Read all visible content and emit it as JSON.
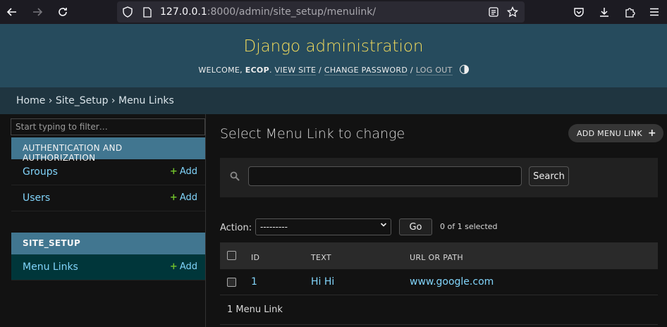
{
  "browser": {
    "url_host": "127.0.0.1",
    "url_path": ":8000/admin/site_setup/menulink/"
  },
  "header": {
    "brand": "Django administration",
    "welcome": "WELCOME, ",
    "username": "ECOP",
    "view_site": "VIEW SITE",
    "change_password": "CHANGE PASSWORD",
    "log_out": "LOG OUT",
    "sep": " / "
  },
  "breadcrumbs": {
    "home": "Home",
    "app": "Site_Setup",
    "current": "Menu Links",
    "sep": " › "
  },
  "sidebar": {
    "filter_placeholder": "Start typing to filter…",
    "apps": [
      {
        "caption": "AUTHENTICATION AND AUTHORIZATION",
        "models": [
          {
            "label": "Groups",
            "add": "Add"
          },
          {
            "label": "Users",
            "add": "Add"
          }
        ]
      },
      {
        "caption": "SITE_SETUP",
        "models": [
          {
            "label": "Menu Links",
            "add": "Add"
          }
        ]
      }
    ]
  },
  "main": {
    "title": "Select Menu Link to change",
    "add_button": "ADD MENU LINK",
    "search_button": "Search",
    "action_label": "Action:",
    "action_selected": "---------",
    "go_button": "Go",
    "selected_count": "0 of 1 selected",
    "columns": [
      "ID",
      "TEXT",
      "URL OR PATH"
    ],
    "rows": [
      {
        "id": "1",
        "text": "Hi Hi",
        "url": "www.google.com"
      }
    ],
    "paginator": "1 Menu Link"
  },
  "colors": {
    "header_bg": "#264b5d",
    "brand": "#f5dd5d",
    "breadcrumb_bg": "#1f3540",
    "caption_bg": "#417690",
    "link": "#81d4fa",
    "add_plus": "#70bf2b"
  }
}
